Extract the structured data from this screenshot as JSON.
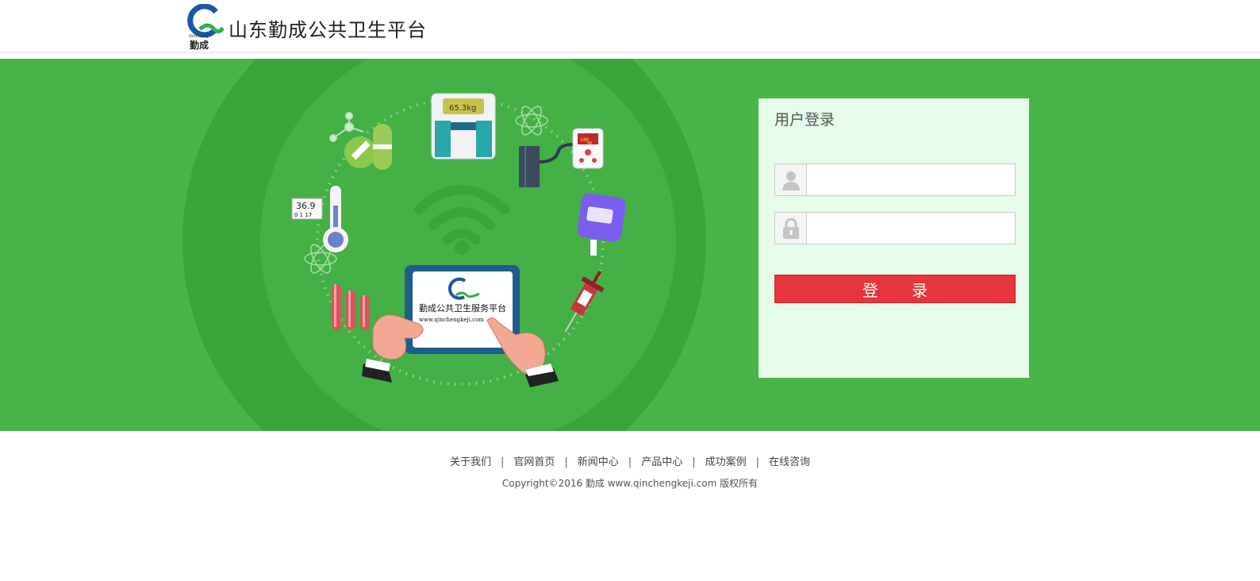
{
  "header": {
    "logo_caption": "勤成",
    "logo_tiny": "QinCheng",
    "title": "山东勤成公共卫生平台"
  },
  "illustration": {
    "thermometer_reading": "36.9",
    "thermometer_time": "0 1 17",
    "scale_reading": "65.3kg",
    "bp_reading_1": "140",
    "bp_reading_2": "90",
    "tablet_title": "勤成公共卫生服务平台",
    "tablet_url": "www.qinchengkeji.com"
  },
  "login": {
    "title": "用户登录",
    "username_value": "",
    "password_value": "",
    "submit_label": "登 录"
  },
  "footer": {
    "links": [
      "关于我们",
      "官网首页",
      "新闻中心",
      "产品中心",
      "成功案例",
      "在线咨询"
    ],
    "separator": "|",
    "copyright": "Copyright©2016 勤成 www.qinchengkeji.com 版权所有"
  },
  "colors": {
    "banner_green": "#47b548",
    "panel_bg": "#e6fbe9",
    "button_red": "#e5343b"
  }
}
